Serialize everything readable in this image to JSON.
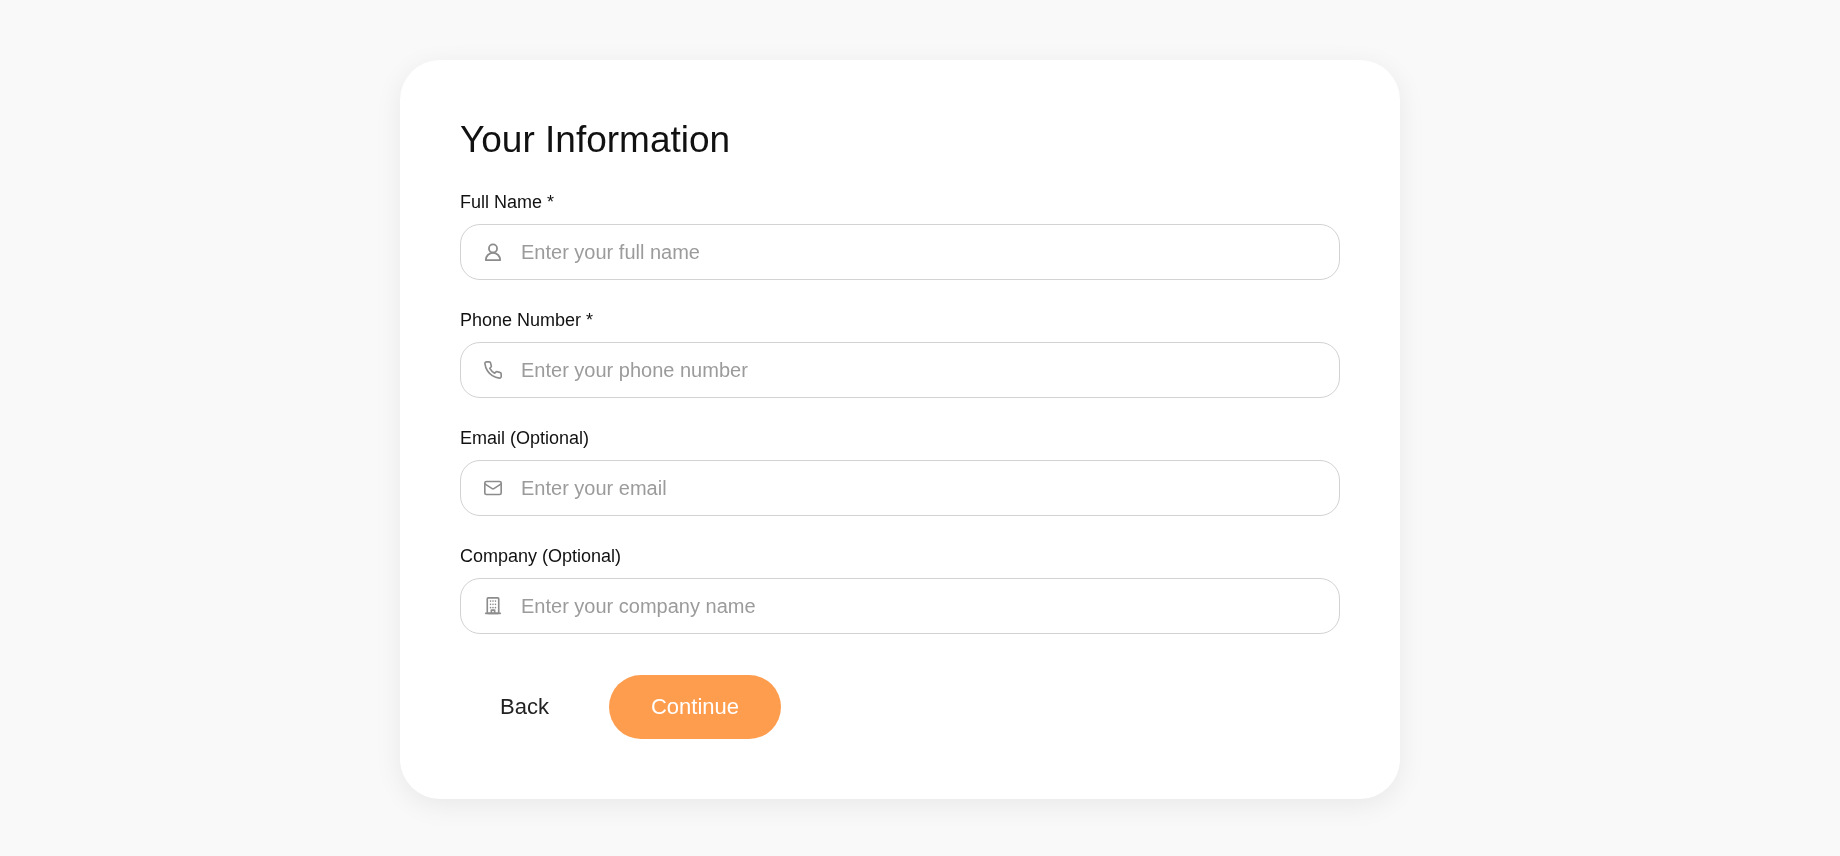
{
  "form": {
    "title": "Your Information",
    "fields": [
      {
        "kind": "name",
        "label": "Full Name *",
        "placeholder": "Enter your full name"
      },
      {
        "kind": "phone",
        "label": "Phone Number *",
        "placeholder": "Enter your phone number"
      },
      {
        "kind": "email",
        "label": "Email (Optional)",
        "placeholder": "Enter your email"
      },
      {
        "kind": "company",
        "label": "Company (Optional)",
        "placeholder": "Enter your company name"
      }
    ],
    "buttons": [
      {
        "kind": "secondary",
        "label": "Back"
      },
      {
        "kind": "primary",
        "label": "Continue"
      }
    ]
  }
}
